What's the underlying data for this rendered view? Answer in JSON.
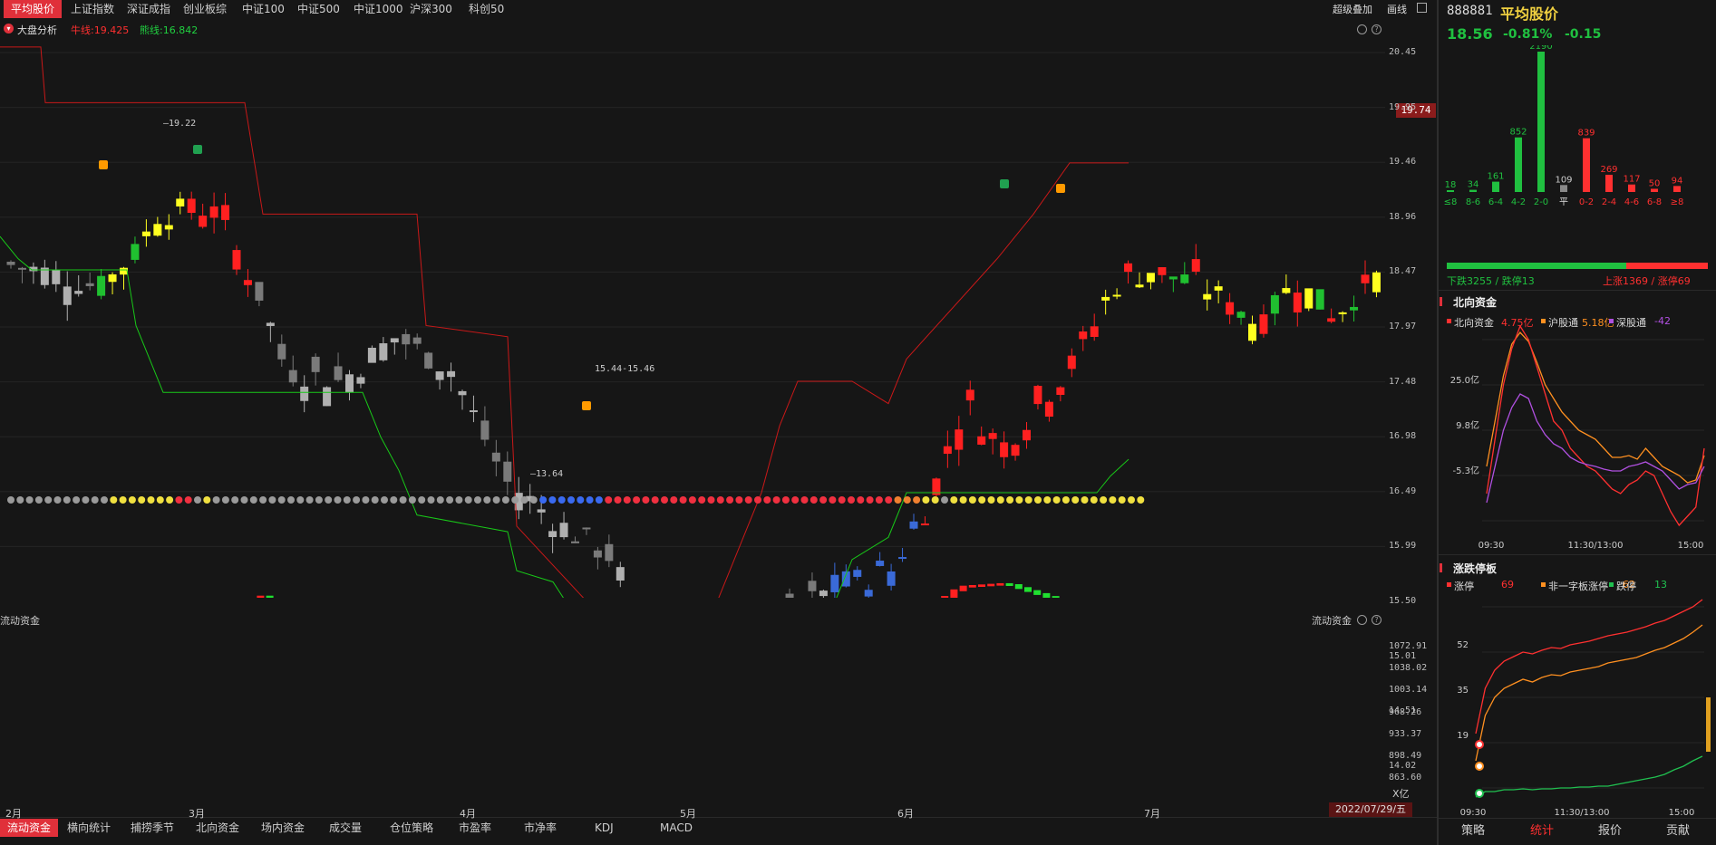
{
  "tabs": [
    {
      "label": "平均股价",
      "active": true
    },
    {
      "label": "上证指数"
    },
    {
      "label": "深证成指"
    },
    {
      "label": "创业板综"
    },
    {
      "label": "中证100"
    },
    {
      "label": "中证500"
    },
    {
      "label": "中证1000"
    },
    {
      "label": "沪深300"
    },
    {
      "label": "科创50"
    }
  ],
  "toolbar": {
    "overlay": "超级叠加",
    "draw": "画线"
  },
  "chart_header": {
    "title": "大盘分析",
    "bull_label": "牛线:19.425",
    "bear_label": "熊线:16.842"
  },
  "price_axis": [
    "20.45",
    "19.95",
    "19.46",
    "18.96",
    "18.47",
    "17.97",
    "17.48",
    "16.98",
    "16.49",
    "15.99",
    "15.50",
    "15.01",
    "14.51",
    "14.02"
  ],
  "current_price_tag": "19.74",
  "annotations": {
    "high": "19.22",
    "low": "13.64",
    "range": "15.44-15.46"
  },
  "flow_panel": {
    "title": "流动资金",
    "axis": [
      "1072.91",
      "1038.02",
      "1003.14",
      "968.26",
      "933.37",
      "898.49",
      "863.60"
    ],
    "unit": "X亿"
  },
  "month_labels": [
    "2月",
    "3月",
    "4月",
    "5月",
    "6月",
    "7月"
  ],
  "date_tag": "2022/07/29/五",
  "bottom_tabs": [
    {
      "label": "流动资金",
      "active": true
    },
    {
      "label": "横向统计"
    },
    {
      "label": "捕捞季节"
    },
    {
      "label": "北向资金"
    },
    {
      "label": "场内资金"
    },
    {
      "label": "成交量"
    },
    {
      "label": "仓位策略"
    },
    {
      "label": "市盈率"
    },
    {
      "label": "市净率"
    },
    {
      "label": "KDJ"
    },
    {
      "label": "MACD"
    }
  ],
  "quote": {
    "code": "888881",
    "name": "平均股价",
    "price": "18.56",
    "change_pct": "-0.81%",
    "change": "-0.15"
  },
  "distribution": {
    "labels": [
      "≤8",
      "8-6",
      "6-4",
      "4-2",
      "2-0",
      "平",
      "0-2",
      "2-4",
      "4-6",
      "6-8",
      "≥8"
    ],
    "values": [
      18,
      34,
      161,
      852,
      2190,
      109,
      839,
      269,
      117,
      50,
      94
    ],
    "down_text": "下跌3255 / 跌停13",
    "up_text": "上涨1369 / 涨停69"
  },
  "north": {
    "title": "北向资金",
    "legend": [
      {
        "name": "北向资金",
        "value": "4.75亿",
        "color": "#ff3030"
      },
      {
        "name": "沪股通",
        "value": "5.18亿",
        "color": "#ff9020"
      },
      {
        "name": "深股通",
        "value": "-42",
        "color": "#b050e0"
      }
    ],
    "yaxis": [
      "25.0亿",
      "9.8亿",
      "-5.3亿"
    ],
    "xaxis": [
      "09:30",
      "11:30/13:00",
      "15:00"
    ]
  },
  "limit": {
    "title": "涨跌停板",
    "legend": [
      {
        "name": "涨停",
        "value": "69",
        "color": "#ff3030"
      },
      {
        "name": "非一字板涨停",
        "value": "62",
        "color": "#ff9020"
      },
      {
        "name": "跌停",
        "value": "13",
        "color": "#20c050"
      }
    ],
    "yaxis": [
      "52",
      "35",
      "19"
    ],
    "xaxis": [
      "09:30",
      "11:30/13:00",
      "15:00"
    ]
  },
  "right_tabs": [
    {
      "label": "策略"
    },
    {
      "label": "统计",
      "active": true
    },
    {
      "label": "报价"
    },
    {
      "label": "贡献"
    }
  ],
  "colors": {
    "up": "#ff2020",
    "down": "#20c030",
    "yellow": "#ffff20",
    "accent": "#e0303a"
  }
}
